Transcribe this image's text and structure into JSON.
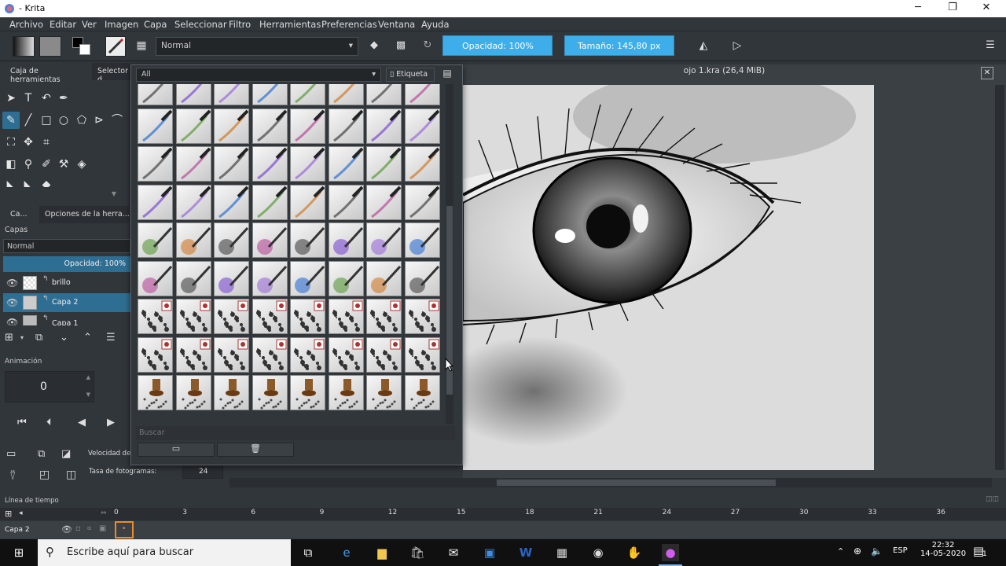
{
  "window": {
    "title": "- Krita",
    "controls": {
      "minimize": "─",
      "maximize": "❐",
      "close": "✕"
    }
  },
  "menu": [
    "Archivo",
    "Editar",
    "Ver",
    "Imagen",
    "Capa",
    "Seleccionar",
    "Filtro",
    "Herramientas",
    "Preferencias",
    "Ventana",
    "Ayuda"
  ],
  "toolbar": {
    "blend_mode": "Normal",
    "opacity": "Opacidad: 100%",
    "size": "Tamaño: 145,80 px"
  },
  "left_dock": {
    "tabs": [
      "Caja de herramientas",
      "Selector d"
    ],
    "layers_tabs": [
      "Ca...",
      "Opciones de la herra..."
    ],
    "layers_title": "Capas",
    "layers_blend": "Normal",
    "layers_opacity": "Opacidad:  100%",
    "layers": [
      {
        "name": "brillo",
        "selected": false
      },
      {
        "name": "Capa 2",
        "selected": true
      },
      {
        "name": "Capa 1",
        "selected": false
      }
    ],
    "animation_title": "Animación",
    "frame_value": "0",
    "playback_speed_label": "Velocidad de",
    "framerate_label": "Tasa de fotogramas:",
    "framerate_value": "24"
  },
  "brush_popup": {
    "filter": "All",
    "tag_label": "Etiqueta",
    "search_placeholder": "Buscar",
    "rows": 9,
    "cols": 8
  },
  "document": {
    "title": "ojo 1.kra (26,4 MiB)"
  },
  "timeline": {
    "title": "Línea de tiempo",
    "layer_name": "Capa 2",
    "ticks": [
      "0",
      "3",
      "6",
      "9",
      "12",
      "15",
      "18",
      "21",
      "24",
      "27",
      "30",
      "33",
      "36"
    ]
  },
  "taskbar": {
    "search_placeholder": "Escribe aquí para buscar",
    "language": "ESP",
    "time": "22:32",
    "date": "14-05-2020",
    "notification_count": "1"
  },
  "colors": {
    "accent": "#3daee9",
    "selection": "#2f6e93",
    "panel": "#31363b"
  }
}
